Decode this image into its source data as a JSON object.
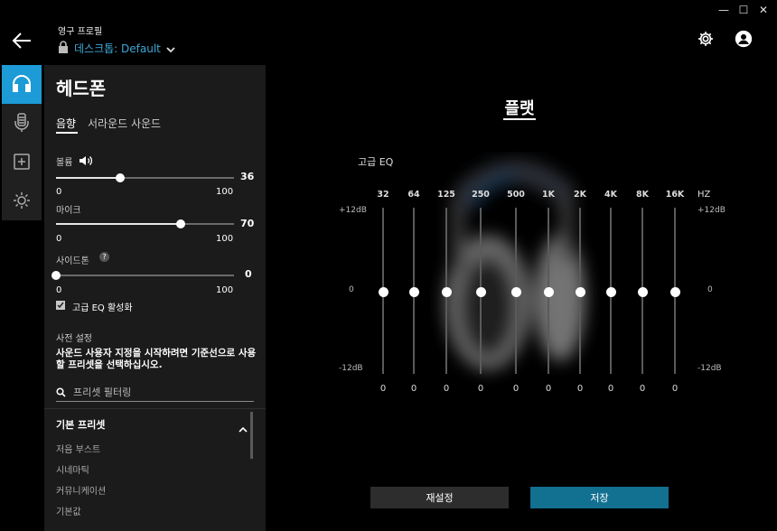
{
  "header": {
    "profile_label": "영구 프로필",
    "profile_value": "데스크톱: Default"
  },
  "panel": {
    "title": "헤드폰",
    "tabs": [
      {
        "label": "음향"
      },
      {
        "label": "서라운드 사운드"
      }
    ],
    "volume": {
      "label": "볼륨",
      "value": "36",
      "min": "0",
      "max": "100",
      "level": 0.36
    },
    "mic": {
      "label": "마이크",
      "value": "70",
      "min": "0",
      "max": "100",
      "level": 0.7
    },
    "sidetone": {
      "label": "사이드톤",
      "help": "?",
      "value": "0",
      "min": "0",
      "max": "100",
      "level": 0
    },
    "advanced_eq_checkbox": {
      "label": "고급 EQ 활성화",
      "checked": true
    },
    "presets": {
      "heading": "사전 설정",
      "description": "사운드 사용자 지정을 시작하려면 기준선으로 사용할 프리셋을 선택하십시오.",
      "filter_placeholder": "프리셋 필터링",
      "section_title": "기본 프리셋",
      "items": [
        "저음 부스트",
        "시네마틱",
        "커뮤니케이션",
        "기본값"
      ]
    }
  },
  "eq": {
    "mode_title": "플랫",
    "label": "고급 EQ",
    "unit": "HZ",
    "db_top": "+12dB",
    "db_mid": "0",
    "db_bottom": "-12dB",
    "bands": [
      {
        "freq": "32",
        "value": "0"
      },
      {
        "freq": "64",
        "value": "0"
      },
      {
        "freq": "125",
        "value": "0"
      },
      {
        "freq": "250",
        "value": "0"
      },
      {
        "freq": "500",
        "value": "0"
      },
      {
        "freq": "1K",
        "value": "0"
      },
      {
        "freq": "2K",
        "value": "0"
      },
      {
        "freq": "4K",
        "value": "0"
      },
      {
        "freq": "8K",
        "value": "0"
      },
      {
        "freq": "16K",
        "value": "0"
      }
    ]
  },
  "buttons": {
    "reset": "재설정",
    "save": "저장"
  },
  "colors": {
    "accent": "#1c9bd6",
    "save": "#127090",
    "profile_value": "#3fa7d6"
  }
}
